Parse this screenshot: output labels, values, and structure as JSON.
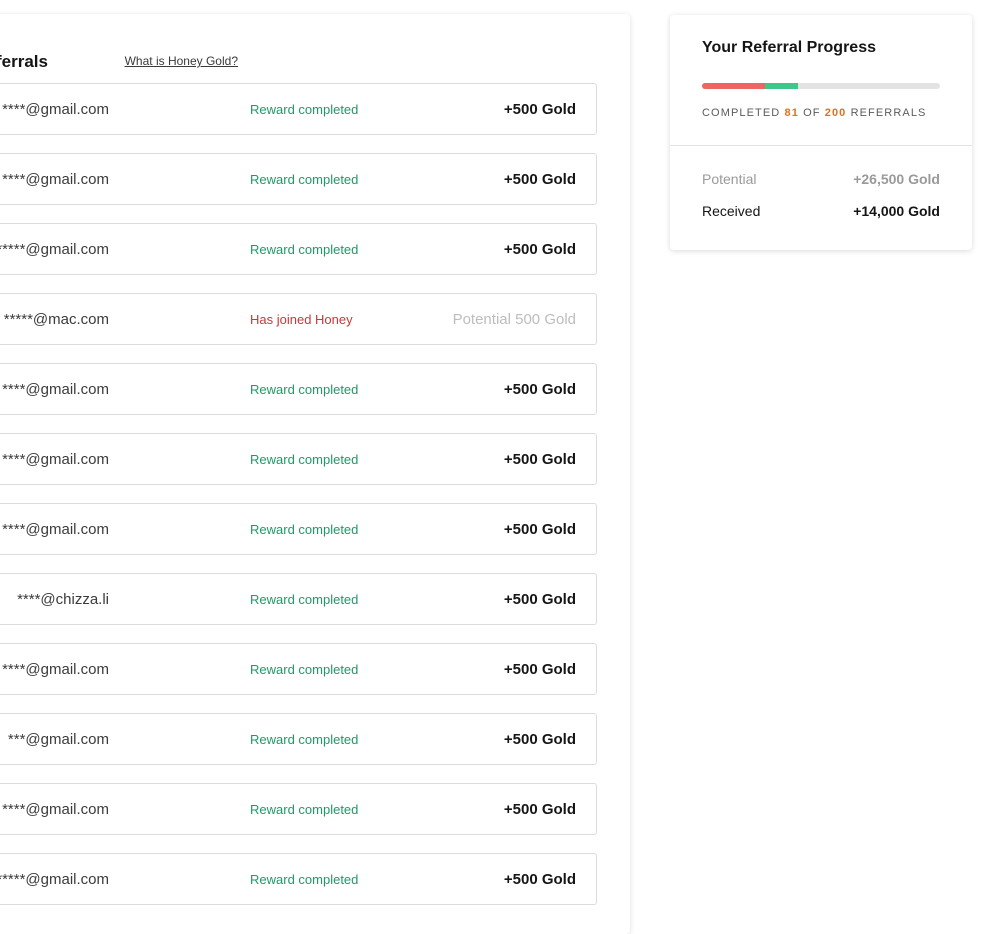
{
  "referrals": {
    "title": "Your Referrals",
    "link": "What is Honey Gold?",
    "rows": [
      {
        "email": "****@gmail.com",
        "status": "Reward completed",
        "status_type": "completed",
        "reward": "+500 Gold"
      },
      {
        "email": "****@gmail.com",
        "status": "Reward completed",
        "status_type": "completed",
        "reward": "+500 Gold"
      },
      {
        "email": "*****@gmail.com",
        "status": "Reward completed",
        "status_type": "completed",
        "reward": "+500 Gold"
      },
      {
        "email": "*****@mac.com",
        "status": "Has joined Honey",
        "status_type": "joined",
        "reward": "Potential 500 Gold"
      },
      {
        "email": "****@gmail.com",
        "status": "Reward completed",
        "status_type": "completed",
        "reward": "+500 Gold"
      },
      {
        "email": "****@gmail.com",
        "status": "Reward completed",
        "status_type": "completed",
        "reward": "+500 Gold"
      },
      {
        "email": "****@gmail.com",
        "status": "Reward completed",
        "status_type": "completed",
        "reward": "+500 Gold"
      },
      {
        "email": "****@chizza.li",
        "status": "Reward completed",
        "status_type": "completed",
        "reward": "+500 Gold"
      },
      {
        "email": "****@gmail.com",
        "status": "Reward completed",
        "status_type": "completed",
        "reward": "+500 Gold"
      },
      {
        "email": "***@gmail.com",
        "status": "Reward completed",
        "status_type": "completed",
        "reward": "+500 Gold"
      },
      {
        "email": "****@gmail.com",
        "status": "Reward completed",
        "status_type": "completed",
        "reward": "+500 Gold"
      },
      {
        "email": "*****@gmail.com",
        "status": "Reward completed",
        "status_type": "completed",
        "reward": "+500 Gold"
      }
    ]
  },
  "progress": {
    "title": "Your Referral Progress",
    "completed_prefix": "COMPLETED",
    "completed": "81",
    "of_label": "OF",
    "total": "200",
    "suffix": "REFERRALS",
    "bar_red_fraction": 0.265,
    "bar_green_fraction": 0.14,
    "potential_label": "Potential",
    "potential_value": "+26,500 Gold",
    "received_label": "Received",
    "received_value": "+14,000 Gold"
  },
  "colors": {
    "completed": "#1e9a66",
    "joined": "#c8373a",
    "accent_number": "#e0701f",
    "bar_red": "#f06461",
    "bar_green": "#3fc68a"
  }
}
